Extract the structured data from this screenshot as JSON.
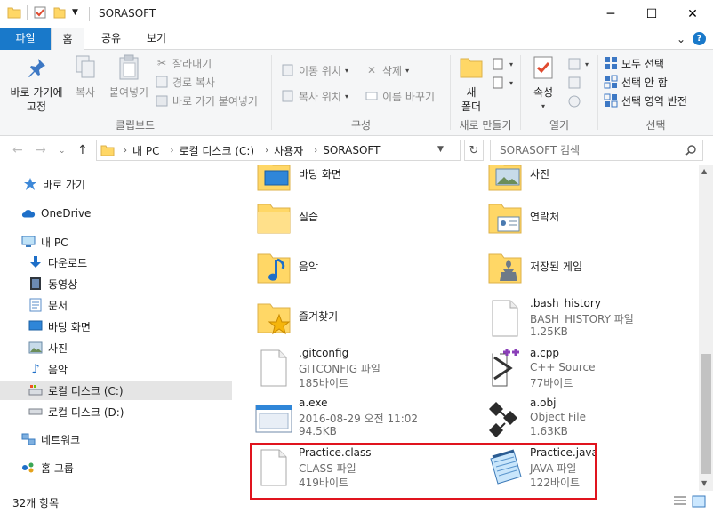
{
  "window": {
    "title": "SORASOFT",
    "minimize": "─",
    "maximize": "☐",
    "close": "✕"
  },
  "ribbon_tabs": {
    "file": "파일",
    "home": "홈",
    "share": "공유",
    "view": "보기",
    "expand": "⌄",
    "help": "?"
  },
  "ribbon": {
    "clipboard": {
      "label": "클립보드",
      "pin": "바로 가기에\n고정",
      "pin_l1": "바로 가기에",
      "pin_l2": "고정",
      "copy": "복사",
      "paste": "붙여넣기",
      "cut": "잘라내기",
      "copy_path": "경로 복사",
      "paste_shortcut": "바로 가기 붙여넣기"
    },
    "organize": {
      "label": "구성",
      "move_to": "이동 위치",
      "copy_to": "복사 위치",
      "delete": "삭제",
      "rename": "이름 바꾸기"
    },
    "new": {
      "label": "새로 만들기",
      "new_folder_l1": "새",
      "new_folder_l2": "폴더"
    },
    "open": {
      "label": "열기",
      "properties": "속성"
    },
    "select": {
      "label": "선택",
      "select_all": "모두 선택",
      "select_none": "선택 안 함",
      "invert": "선택 영역 반전"
    }
  },
  "address": {
    "crumbs": [
      "내 PC",
      "로컬 디스크 (C:)",
      "사용자",
      "SORASOFT"
    ],
    "search_placeholder": "SORASOFT 검색"
  },
  "nav": {
    "items": [
      {
        "label": "바로 가기",
        "icon": "star-icon"
      },
      {
        "label": "OneDrive",
        "icon": "cloud-icon"
      },
      {
        "label": "내 PC",
        "icon": "computer-icon"
      },
      {
        "label": "다운로드",
        "icon": "download-icon"
      },
      {
        "label": "동영상",
        "icon": "video-icon"
      },
      {
        "label": "문서",
        "icon": "document-icon"
      },
      {
        "label": "바탕 화면",
        "icon": "desktop-icon"
      },
      {
        "label": "사진",
        "icon": "picture-icon"
      },
      {
        "label": "음악",
        "icon": "music-icon"
      },
      {
        "label": "로컬 디스크 (C:)",
        "icon": "drive-icon"
      },
      {
        "label": "로컬 디스크 (D:)",
        "icon": "drive-icon"
      },
      {
        "label": "네트워크",
        "icon": "network-icon"
      },
      {
        "label": "홈 그룹",
        "icon": "homegroup-icon"
      }
    ]
  },
  "files": [
    {
      "name": "바탕 화면",
      "lines": [],
      "icon": "desktop-folder-icon"
    },
    {
      "name": "사진",
      "lines": [],
      "icon": "pictures-folder-icon"
    },
    {
      "name": "실습",
      "lines": [],
      "icon": "folder-icon"
    },
    {
      "name": "연락처",
      "lines": [],
      "icon": "contacts-folder-icon"
    },
    {
      "name": "음악",
      "lines": [],
      "icon": "music-folder-icon"
    },
    {
      "name": "저장된 게임",
      "lines": [],
      "icon": "saved-games-folder-icon"
    },
    {
      "name": "즐겨찾기",
      "lines": [],
      "icon": "favorites-folder-icon"
    },
    {
      "name": ".bash_history",
      "lines": [
        "BASH_HISTORY 파일",
        "1.25KB"
      ],
      "icon": "file-icon"
    },
    {
      "name": ".gitconfig",
      "lines": [
        "GITCONFIG 파일",
        "185바이트"
      ],
      "icon": "file-icon"
    },
    {
      "name": "a.cpp",
      "lines": [
        "C++ Source",
        "77바이트"
      ],
      "icon": "cpp-file-icon"
    },
    {
      "name": "a.exe",
      "lines": [
        "2016-08-29 오전 11:02",
        "94.5KB"
      ],
      "icon": "exe-file-icon"
    },
    {
      "name": "a.obj",
      "lines": [
        "Object File",
        "1.63KB"
      ],
      "icon": "obj-file-icon"
    },
    {
      "name": "Practice.class",
      "lines": [
        "CLASS 파일",
        "419바이트"
      ],
      "icon": "file-icon"
    },
    {
      "name": "Practice.java",
      "lines": [
        "JAVA 파일",
        "122바이트"
      ],
      "icon": "notepad-file-icon"
    }
  ],
  "status": {
    "count": "32개 항목"
  },
  "colors": {
    "accent": "#1979ca",
    "folder": "#ffd766",
    "highlight_box": "#e0141e",
    "nav_selected": "#cce8ff"
  }
}
